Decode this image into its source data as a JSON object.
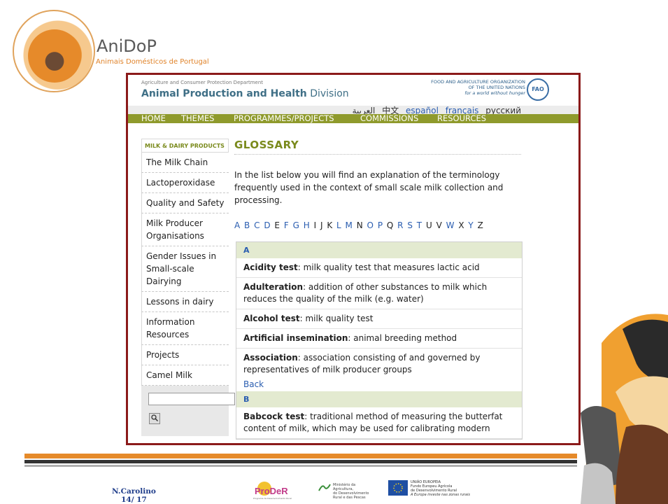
{
  "slide": {
    "brand_name": "AniDoP",
    "brand_sub": "Animais Domésticos de Portugal",
    "author": "N.Carolino",
    "page": "14/ 17"
  },
  "fao": {
    "department": "Agriculture and Consumer Protection Department",
    "division_bold": "Animal Production and Health",
    "division_rest": " Division",
    "org_line1": "FOOD AND AGRICULTURE ORGANIZATION",
    "org_line2": "OF THE UNITED NATIONS",
    "org_line3": "for a world without hunger",
    "logo": "FAO"
  },
  "languages": [
    "العربية",
    "中文",
    "español",
    "français",
    "русский"
  ],
  "nav": [
    "HOME",
    "THEMES",
    "PROGRAMMES/PROJECTS",
    "COMMISSIONS",
    "RESOURCES"
  ],
  "sidebar": {
    "heading": "MILK & DAIRY PRODUCTS",
    "items": [
      "The Milk Chain",
      "Lactoperoxidase",
      "Quality and Safety",
      "Milk Producer Organisations",
      "Gender Issues in Small-scale Dairying",
      "Lessons in dairy",
      "Information Resources",
      "Projects",
      "Camel Milk"
    ],
    "search_icon": "magnifier-icon"
  },
  "main": {
    "title": "GLOSSARY",
    "intro": "In the list below you will find an explanation of the terminology frequently used in the context of small scale milk collection and processing.",
    "alphabet_links": [
      "A",
      "B",
      "C",
      "D",
      "E",
      "F",
      "G",
      "H",
      "I",
      "J",
      "K",
      "L",
      "M",
      "N",
      "O",
      "P",
      "Q",
      "R",
      "S",
      "T",
      "U",
      "V",
      "W",
      "X",
      "Y",
      "Z"
    ],
    "sections": [
      {
        "letter": "A",
        "entries": [
          {
            "term": "Acidity test",
            "def": ": milk quality test that measures lactic acid"
          },
          {
            "term": "Adulteration",
            "def": ": addition of other substances to milk which reduces the quality of the milk (e.g. water)"
          },
          {
            "term": "Alcohol test",
            "def": ": milk quality test"
          },
          {
            "term": "Artificial insemination",
            "def": ": animal breeding method"
          },
          {
            "term": "Association",
            "def": ": association consisting of and governed by representatives of milk producer groups"
          }
        ],
        "back": "Back"
      },
      {
        "letter": "B",
        "entries": [
          {
            "term": "Babcock test",
            "def": ": traditional method of measuring the butterfat content of milk, which may be used for calibrating modern"
          }
        ]
      }
    ]
  },
  "footer_logos": {
    "prodner": "ProDeR",
    "prodner_sub": "Programa de Desenvolvimento Rural",
    "ministerio": [
      "Ministério da",
      "Agricultura,",
      "do Desenvolvimento",
      "Rural e das Pescas"
    ],
    "ue": [
      "UNIÃO EUROPEIA",
      "Fundo Europeu Agrícola",
      "de Desenvolvimento Rural",
      "A Europa investe nas zonas rurais"
    ]
  },
  "colors": {
    "frame": "#8b1a1a",
    "nav_bar": "#8f9a2c",
    "link": "#2a5db0",
    "brand_orange": "#e58a2a"
  }
}
